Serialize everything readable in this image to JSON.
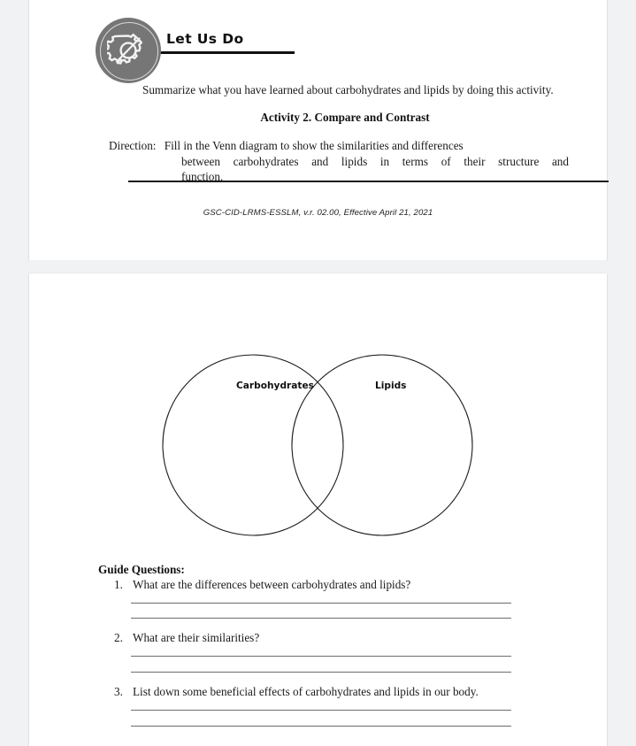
{
  "document": {
    "page_one": {
      "header": {
        "icon": "gear-pencil-icon",
        "title": "Let Us Do"
      },
      "intro_paragraph": "Summarize what you have learned about carbohydrates and lipids by doing this activity.",
      "activity_title": "Activity 2. Compare and Contrast",
      "direction_label": "Direction:",
      "direction_line_1": "Fill in the Venn diagram to show the similarities and differences",
      "direction_line_2": "between carbohydrates and lipids in terms of their structure and",
      "direction_line_3": "function.",
      "footer": "GSC-CID-LRMS-ESSLM, v.r. 02.00, Effective April 21, 2021"
    },
    "page_two": {
      "venn": {
        "left_label": "Carbohydrates",
        "right_label": "Lipids",
        "stroke_color": "#1a1a1a"
      },
      "guide": {
        "heading": "Guide Questions:",
        "questions": [
          {
            "number": "1.",
            "text": "What are the differences between carbohydrates and lipids?"
          },
          {
            "number": "2.",
            "text": "What are their similarities?"
          },
          {
            "number": "3.",
            "text": "List down some beneficial effects of carbohydrates and lipids in our body."
          }
        ]
      }
    }
  }
}
